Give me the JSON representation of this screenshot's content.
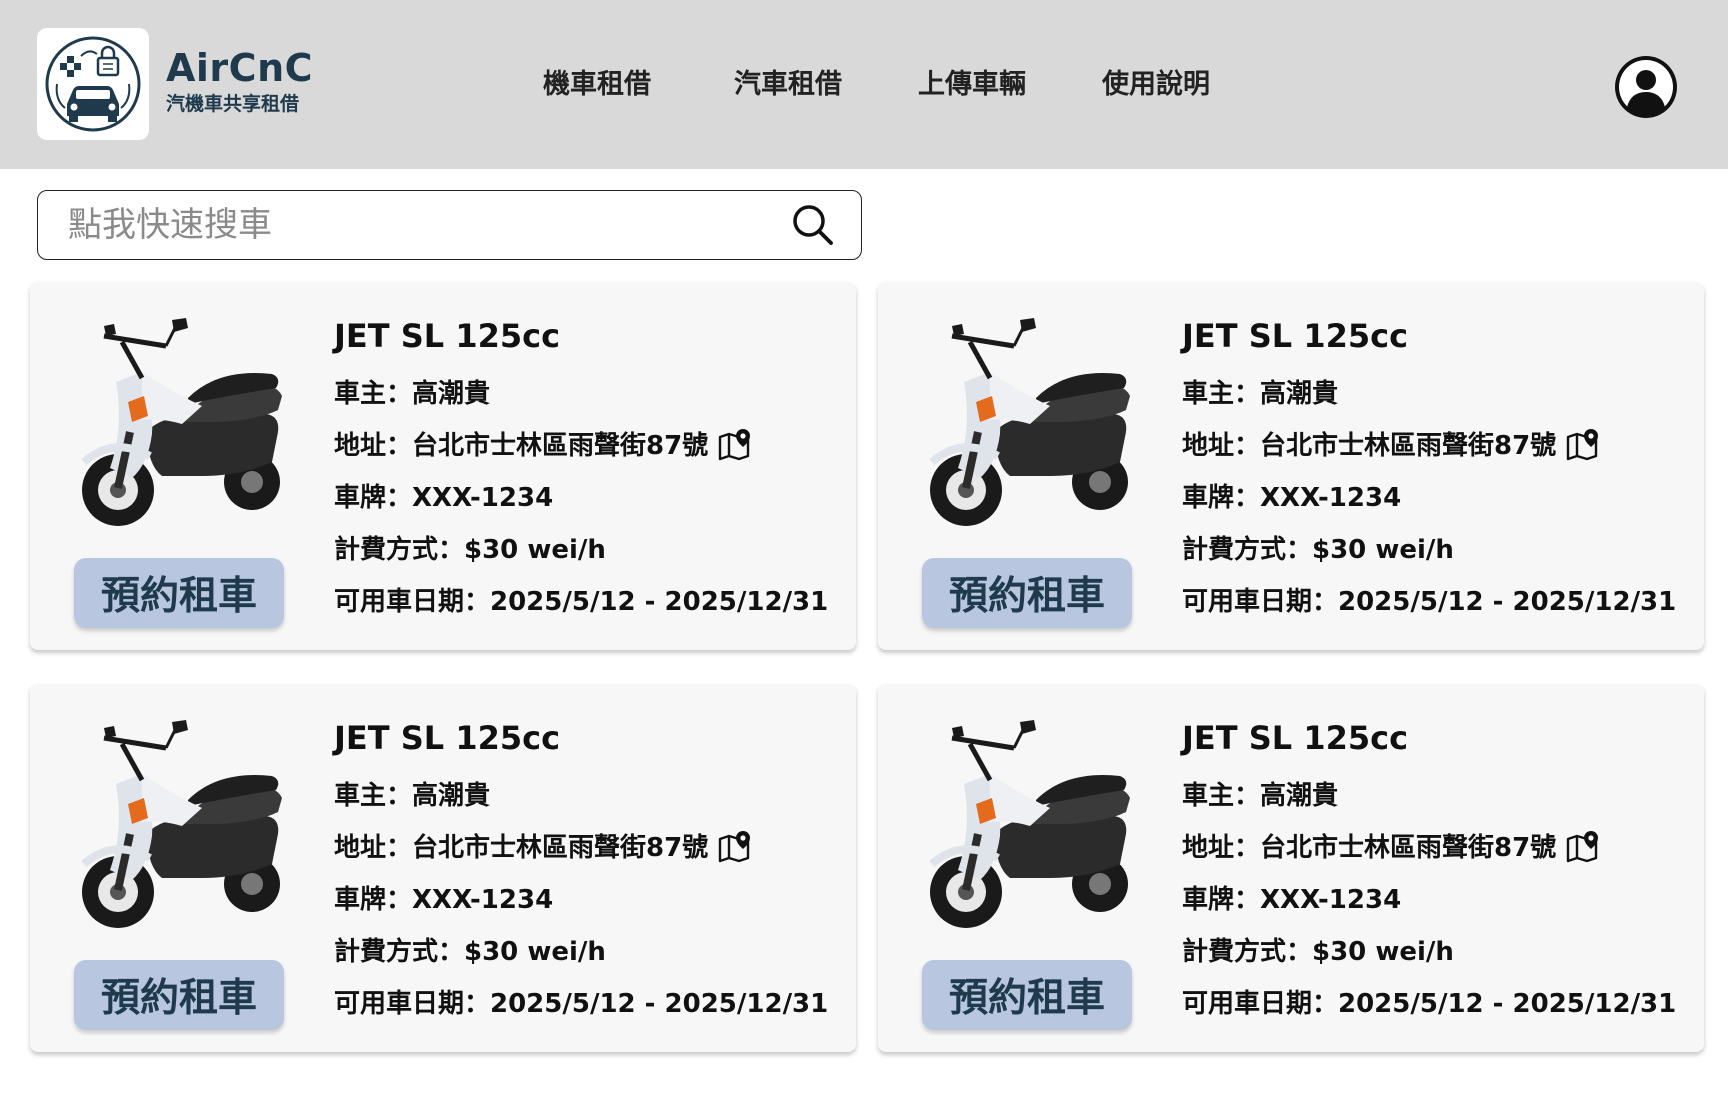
{
  "header": {
    "brand_name": "AirCnC",
    "brand_sub": "汽機車共享租借",
    "nav": [
      "機車租借",
      "汽車租借",
      "上傳車輛",
      "使用說明"
    ]
  },
  "search": {
    "placeholder": "點我快速搜車"
  },
  "listings": [
    {
      "name": "JET SL 125cc",
      "owner": "車主：高潮貴",
      "address": "地址：台北市士林區雨聲街87號",
      "plate": "車牌：XXX-1234",
      "fee": "計費方式：$30 wei/h",
      "dates": "可用車日期：2025/5/12 - 2025/12/31",
      "button": "預約租車"
    },
    {
      "name": "JET SL 125cc",
      "owner": "車主：高潮貴",
      "address": "地址：台北市士林區雨聲街87號",
      "plate": "車牌：XXX-1234",
      "fee": "計費方式：$30 wei/h",
      "dates": "可用車日期：2025/5/12 - 2025/12/31",
      "button": "預約租車"
    },
    {
      "name": "JET SL 125cc",
      "owner": "車主：高潮貴",
      "address": "地址：台北市士林區雨聲街87號",
      "plate": "車牌：XXX-1234",
      "fee": "計費方式：$30 wei/h",
      "dates": "可用車日期：2025/5/12 - 2025/12/31",
      "button": "預約租車"
    },
    {
      "name": "JET SL 125cc",
      "owner": "車主：高潮貴",
      "address": "地址：台北市士林區雨聲街87號",
      "plate": "車牌：XXX-1234",
      "fee": "計費方式：$30 wei/h",
      "dates": "可用車日期：2025/5/12 - 2025/12/31",
      "button": "預約租車"
    }
  ],
  "colors": {
    "header_bg": "#d9d9d9",
    "brand": "#1f3a4d",
    "button_bg": "#b8c6df",
    "card_bg": "#f7f7f7"
  },
  "icons": {
    "logo": "car-share-logo-icon",
    "avatar": "user-avatar-icon",
    "search": "search-icon",
    "map": "map-pin-icon",
    "vehicle": "scooter-image"
  }
}
